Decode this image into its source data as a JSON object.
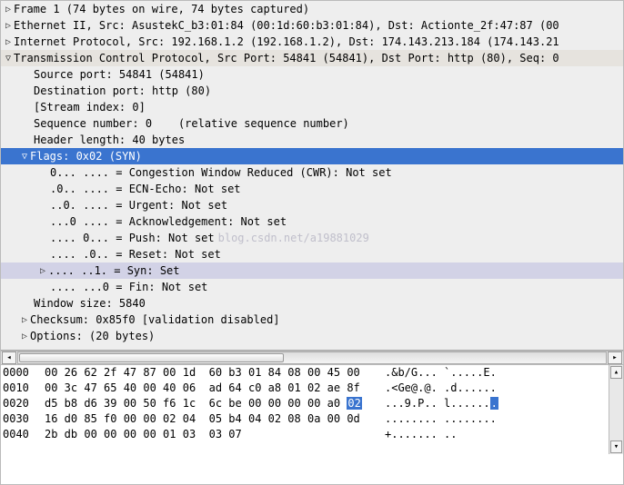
{
  "tree": {
    "frame": "Frame 1 (74 bytes on wire, 74 bytes captured)",
    "eth": "Ethernet II, Src: AsustekC_b3:01:84 (00:1d:60:b3:01:84), Dst: Actionte_2f:47:87 (00",
    "ip": "Internet Protocol, Src: 192.168.1.2 (192.168.1.2), Dst: 174.143.213.184 (174.143.21",
    "tcp": "Transmission Control Protocol, Src Port: 54841 (54841), Dst Port: http (80), Seq: 0",
    "tcp_children": {
      "srcport": "Source port: 54841 (54841)",
      "dstport": "Destination port: http (80)",
      "stream": "[Stream index: 0]",
      "seq": "Sequence number: 0    (relative sequence number)",
      "hdrlen": "Header length: 40 bytes",
      "flags": "Flags: 0x02 (SYN)",
      "bits": {
        "cwr": "0... .... = Congestion Window Reduced (CWR): Not set",
        "ecn": ".0.. .... = ECN-Echo: Not set",
        "urg": "..0. .... = Urgent: Not set",
        "ack": "...0 .... = Acknowledgement: Not set",
        "psh": ".... 0... = Push: Not set",
        "rst": ".... .0.. = Reset: Not set",
        "syn": ".... ..1. = Syn: Set",
        "fin": ".... ...0 = Fin: Not set"
      },
      "win": "Window size: 5840",
      "chk": "Checksum: 0x85f0 [validation disabled]",
      "opt": "Options: (20 bytes)"
    }
  },
  "watermark_tail": "blog.csdn.net/a19881029",
  "hex": {
    "rows": [
      {
        "off": "0000",
        "hex": "00 26 62 2f 47 87 00 1d  60 b3 01 84 08 00 45 00",
        "asc": ".&b/G... `.....E."
      },
      {
        "off": "0010",
        "hex": "00 3c 47 65 40 00 40 06  ad 64 c0 a8 01 02 ae 8f",
        "asc": ".<Ge@.@. .d......"
      },
      {
        "off": "0020",
        "hex_a": "d5 b8 d6 39 00 50 f6 1c  6c be 00 00 00 00 a0 ",
        "hex_hl": "02",
        "asc_a": "...9.P.. l......",
        "asc_hl": "."
      },
      {
        "off": "0030",
        "hex": "16 d0 85 f0 00 00 02 04  05 b4 04 02 08 0a 00 0d",
        "asc": "........ ........"
      },
      {
        "off": "0040",
        "hex": "2b db 00 00 00 00 01 03  03 07",
        "asc": "+....... .."
      }
    ]
  },
  "arrows": {
    "right": "▷",
    "down": "▽"
  }
}
